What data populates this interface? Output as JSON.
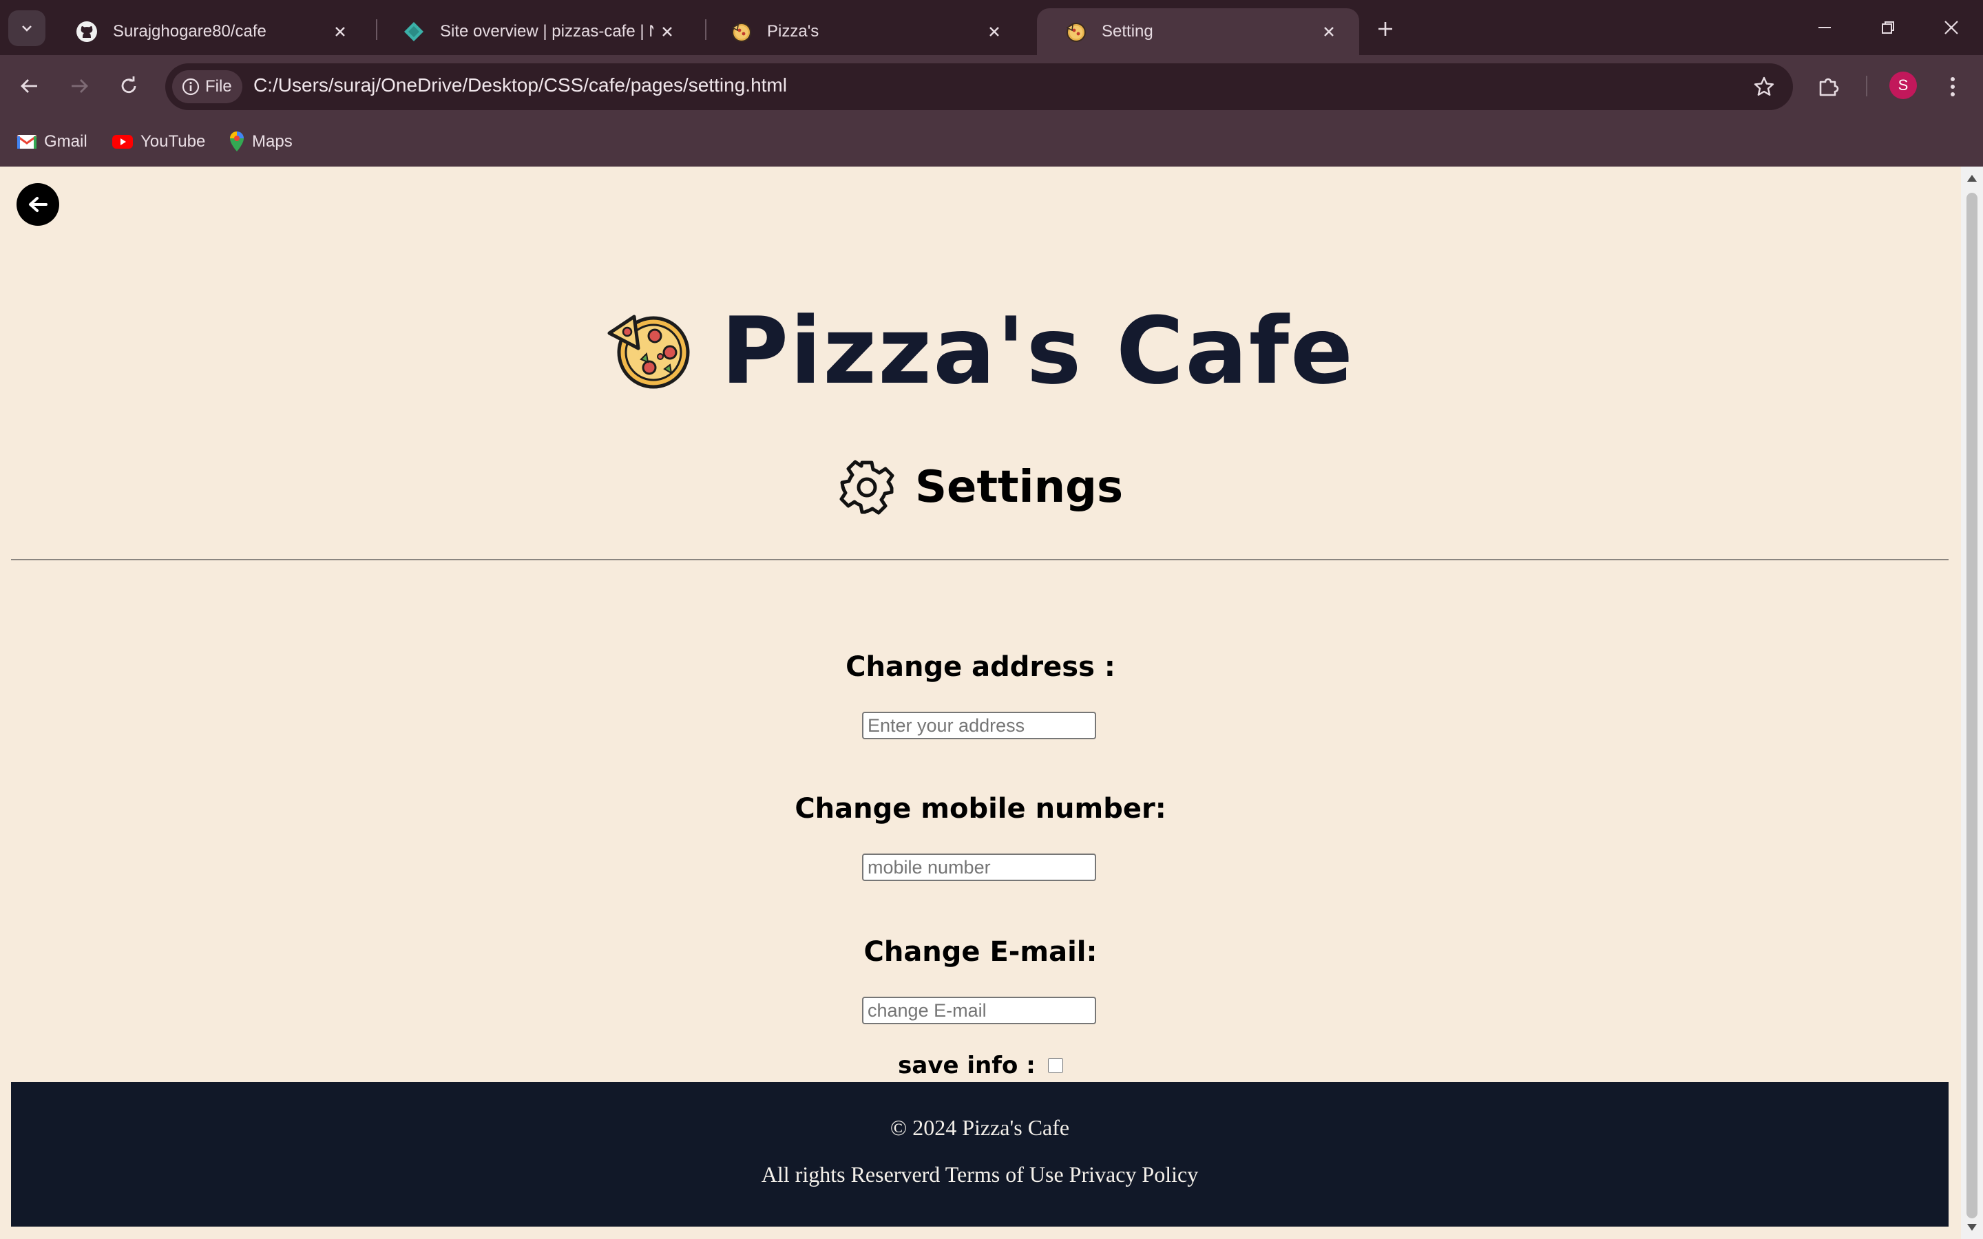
{
  "browser": {
    "tabs": [
      {
        "title": "Surajghogare80/cafe",
        "icon": "github-icon"
      },
      {
        "title": "Site overview | pizzas-cafe | Netlify",
        "icon": "netlify-icon"
      },
      {
        "title": "Pizza's",
        "icon": "pizza-icon"
      },
      {
        "title": "Setting",
        "icon": "pizza-icon",
        "active": true
      }
    ],
    "omnibox": {
      "chip_label": "File",
      "url": "C:/Users/suraj/OneDrive/Desktop/CSS/cafe/pages/setting.html"
    },
    "profile_initial": "S",
    "bookmarks": [
      {
        "label": "Gmail",
        "icon": "gmail-icon"
      },
      {
        "label": "YouTube",
        "icon": "youtube-icon"
      },
      {
        "label": "Maps",
        "icon": "maps-icon"
      }
    ],
    "colors": {
      "tabstrip": "#301d26",
      "toolbar": "#4b3540"
    }
  },
  "page": {
    "brand_title": "Pizza's Cafe",
    "settings_title": "Settings",
    "fields": [
      {
        "label": "Change address :",
        "placeholder": "Enter your address"
      },
      {
        "label": "Change mobile number:",
        "placeholder": "mobile number"
      },
      {
        "label": "Change E-mail:",
        "placeholder": "change E-mail"
      }
    ],
    "save_label": "save info :",
    "save_checked": false,
    "footer": {
      "copyright": "© 2024 Pizza's Cafe",
      "rights": "All rights Reserverd Terms of Use Privacy Policy"
    },
    "colors": {
      "background": "#f7ebdc",
      "footer": "#111828",
      "title": "#141a2e"
    }
  }
}
